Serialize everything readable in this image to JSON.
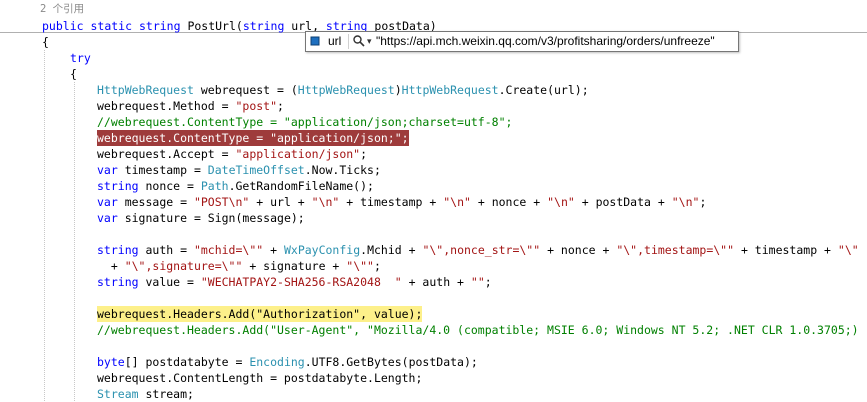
{
  "editor": {
    "reference_count": "2 个引用",
    "lines": [
      {
        "segments": [
          {
            "c": "kw",
            "t": "public"
          },
          {
            "t": " "
          },
          {
            "c": "kw",
            "t": "static"
          },
          {
            "t": " "
          },
          {
            "c": "kw",
            "t": "string"
          },
          {
            "t": " PostUrl("
          },
          {
            "c": "kw",
            "t": "string"
          },
          {
            "t": " url, "
          },
          {
            "c": "kw",
            "t": "string"
          },
          {
            "t": " postData)"
          }
        ]
      },
      {
        "segments": [
          {
            "t": "{"
          }
        ]
      },
      {
        "segments": [
          {
            "c": "kw",
            "t": "try"
          }
        ]
      },
      {
        "segments": [
          {
            "t": "{"
          }
        ]
      },
      {
        "segments": [
          {
            "c": "ty",
            "t": "HttpWebRequest"
          },
          {
            "t": " webrequest = ("
          },
          {
            "c": "ty",
            "t": "HttpWebRequest"
          },
          {
            "t": ")"
          },
          {
            "c": "ty",
            "t": "HttpWebRequest"
          },
          {
            "t": ".Create(url);"
          }
        ]
      },
      {
        "segments": [
          {
            "t": "webrequest.Method = "
          },
          {
            "c": "str",
            "t": "\"post\""
          },
          {
            "t": ";"
          }
        ]
      },
      {
        "segments": [
          {
            "c": "cm",
            "t": "//webrequest.ContentType = \"application/json;charset=utf-8\";"
          }
        ]
      },
      {
        "segments": [
          {
            "c": "bp",
            "t": "webrequest.ContentType = \"application/json;\";"
          }
        ]
      },
      {
        "segments": [
          {
            "t": "webrequest.Accept = "
          },
          {
            "c": "str",
            "t": "\"application/json\""
          },
          {
            "t": ";"
          }
        ]
      },
      {
        "segments": [
          {
            "c": "kw",
            "t": "var"
          },
          {
            "t": " timestamp = "
          },
          {
            "c": "ty",
            "t": "DateTimeOffset"
          },
          {
            "t": ".Now.Ticks;"
          }
        ]
      },
      {
        "segments": [
          {
            "c": "kw",
            "t": "string"
          },
          {
            "t": " nonce = "
          },
          {
            "c": "ty",
            "t": "Path"
          },
          {
            "t": ".GetRandomFileName();"
          }
        ]
      },
      {
        "segments": [
          {
            "c": "kw",
            "t": "var"
          },
          {
            "t": " message = "
          },
          {
            "c": "str",
            "t": "\"POST\\n\""
          },
          {
            "t": " + url + "
          },
          {
            "c": "str",
            "t": "\"\\n\""
          },
          {
            "t": " + timestamp + "
          },
          {
            "c": "str",
            "t": "\"\\n\""
          },
          {
            "t": " + nonce + "
          },
          {
            "c": "str",
            "t": "\"\\n\""
          },
          {
            "t": " + postData + "
          },
          {
            "c": "str",
            "t": "\"\\n\""
          },
          {
            "t": ";"
          }
        ]
      },
      {
        "segments": [
          {
            "c": "kw",
            "t": "var"
          },
          {
            "t": " signature = Sign(message);"
          }
        ]
      },
      {
        "segments": []
      },
      {
        "segments": [
          {
            "c": "kw",
            "t": "string"
          },
          {
            "t": " auth = "
          },
          {
            "c": "str",
            "t": "\"mchid=\\\"\""
          },
          {
            "t": " + "
          },
          {
            "c": "ty",
            "t": "WxPayConfig"
          },
          {
            "t": ".Mchid + "
          },
          {
            "c": "str",
            "t": "\"\\\",nonce_str=\\\"\""
          },
          {
            "t": " + nonce + "
          },
          {
            "c": "str",
            "t": "\"\\\",timestamp=\\\"\""
          },
          {
            "t": " + timestamp + "
          },
          {
            "c": "str",
            "t": "\"\\\""
          }
        ]
      },
      {
        "segments": [
          {
            "t": "  + "
          },
          {
            "c": "str",
            "t": "\"\\\",signature=\\\"\""
          },
          {
            "t": " + signature + "
          },
          {
            "c": "str",
            "t": "\"\\\"\""
          },
          {
            "t": ";"
          }
        ]
      },
      {
        "segments": [
          {
            "c": "kw",
            "t": "string"
          },
          {
            "t": " value = "
          },
          {
            "c": "str",
            "t": "\"WECHATPAY2-SHA256-RSA2048  \""
          },
          {
            "t": " + auth + "
          },
          {
            "c": "str",
            "t": "\"\""
          },
          {
            "t": ";"
          }
        ]
      },
      {
        "segments": []
      },
      {
        "segments": [
          {
            "c": "hl",
            "t": "webrequest.Headers.Add(\"Authorization\", value);"
          }
        ]
      },
      {
        "segments": [
          {
            "c": "cm",
            "t": "//webrequest.Headers.Add(\"User-Agent\", \"Mozilla/4.0 (compatible; MSIE 6.0; Windows NT 5.2; .NET CLR 1.0.3705;)"
          }
        ]
      },
      {
        "segments": []
      },
      {
        "segments": [
          {
            "c": "kw",
            "t": "byte"
          },
          {
            "t": "[] postdatabyte = "
          },
          {
            "c": "ty",
            "t": "Encoding"
          },
          {
            "t": ".UTF8.GetBytes(postData);"
          }
        ]
      },
      {
        "segments": [
          {
            "t": "webrequest.ContentLength = postdatabyte.Length;"
          }
        ]
      },
      {
        "segments": [
          {
            "c": "ty",
            "t": "Stream"
          },
          {
            "t": " stream;"
          }
        ]
      }
    ]
  },
  "datatip": {
    "variable_name": "url",
    "value": "\"https://api.mch.weixin.qq.com/v3/profitsharing/orders/unfreeze\"",
    "icon": "local-variable-icon",
    "search_icon": "magnifier-icon",
    "dropdown_icon": "chevron-down-icon"
  }
}
